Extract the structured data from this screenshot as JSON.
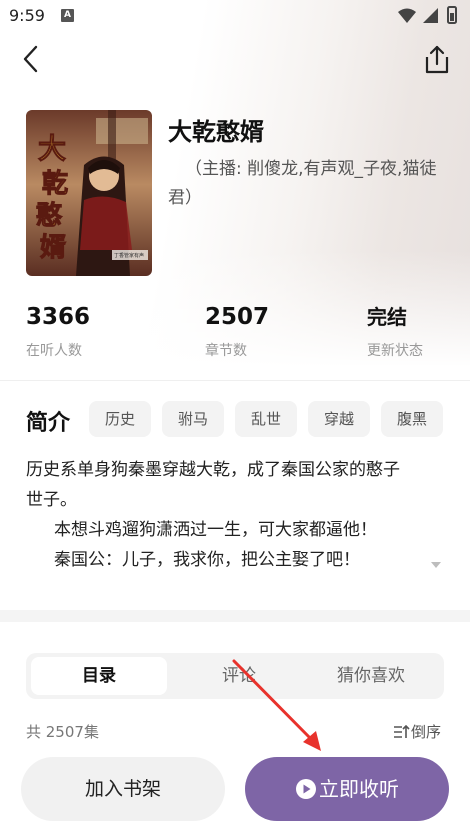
{
  "status_bar": {
    "time": "9:59",
    "notification_letter": "A"
  },
  "book": {
    "title": "大乾憨婿",
    "host": "（主播: 削傻龙,有声观_子夜,猫徒君）",
    "cover_title_art": "大乾憨婿",
    "cover_publisher": "丁香管家有声"
  },
  "stats": [
    {
      "value": "3366",
      "label": "在听人数"
    },
    {
      "value": "2507",
      "label": "章节数"
    },
    {
      "value": "完结",
      "label": "更新状态"
    }
  ],
  "intro": {
    "heading": "简介",
    "tags": [
      "历史",
      "驸马",
      "乱世",
      "穿越",
      "腹黑"
    ],
    "lines": [
      "历史系单身狗秦墨穿越大乾，成了秦国公家的憨子",
      "世子。",
      "本想斗鸡遛狗潇洒过一生，可大家都逼他！",
      "秦国公：儿子，我求你，把公主娶了吧！"
    ]
  },
  "tabs": [
    {
      "label": "目录",
      "active": true
    },
    {
      "label": "评论",
      "active": false
    },
    {
      "label": "猜你喜欢",
      "active": false
    }
  ],
  "episodes": {
    "count_label": "共 2507集",
    "sort_label": "倒序"
  },
  "actions": {
    "shelf_label": "加入书架",
    "listen_label": "立即收听"
  },
  "colors": {
    "accent": "#7e65a6",
    "annotation_arrow": "#e8322c"
  },
  "icons": {
    "back": "chevron-left-icon",
    "share": "share-icon",
    "sort": "sort-icon",
    "play": "play-circle-icon",
    "expand": "caret-down-icon"
  }
}
